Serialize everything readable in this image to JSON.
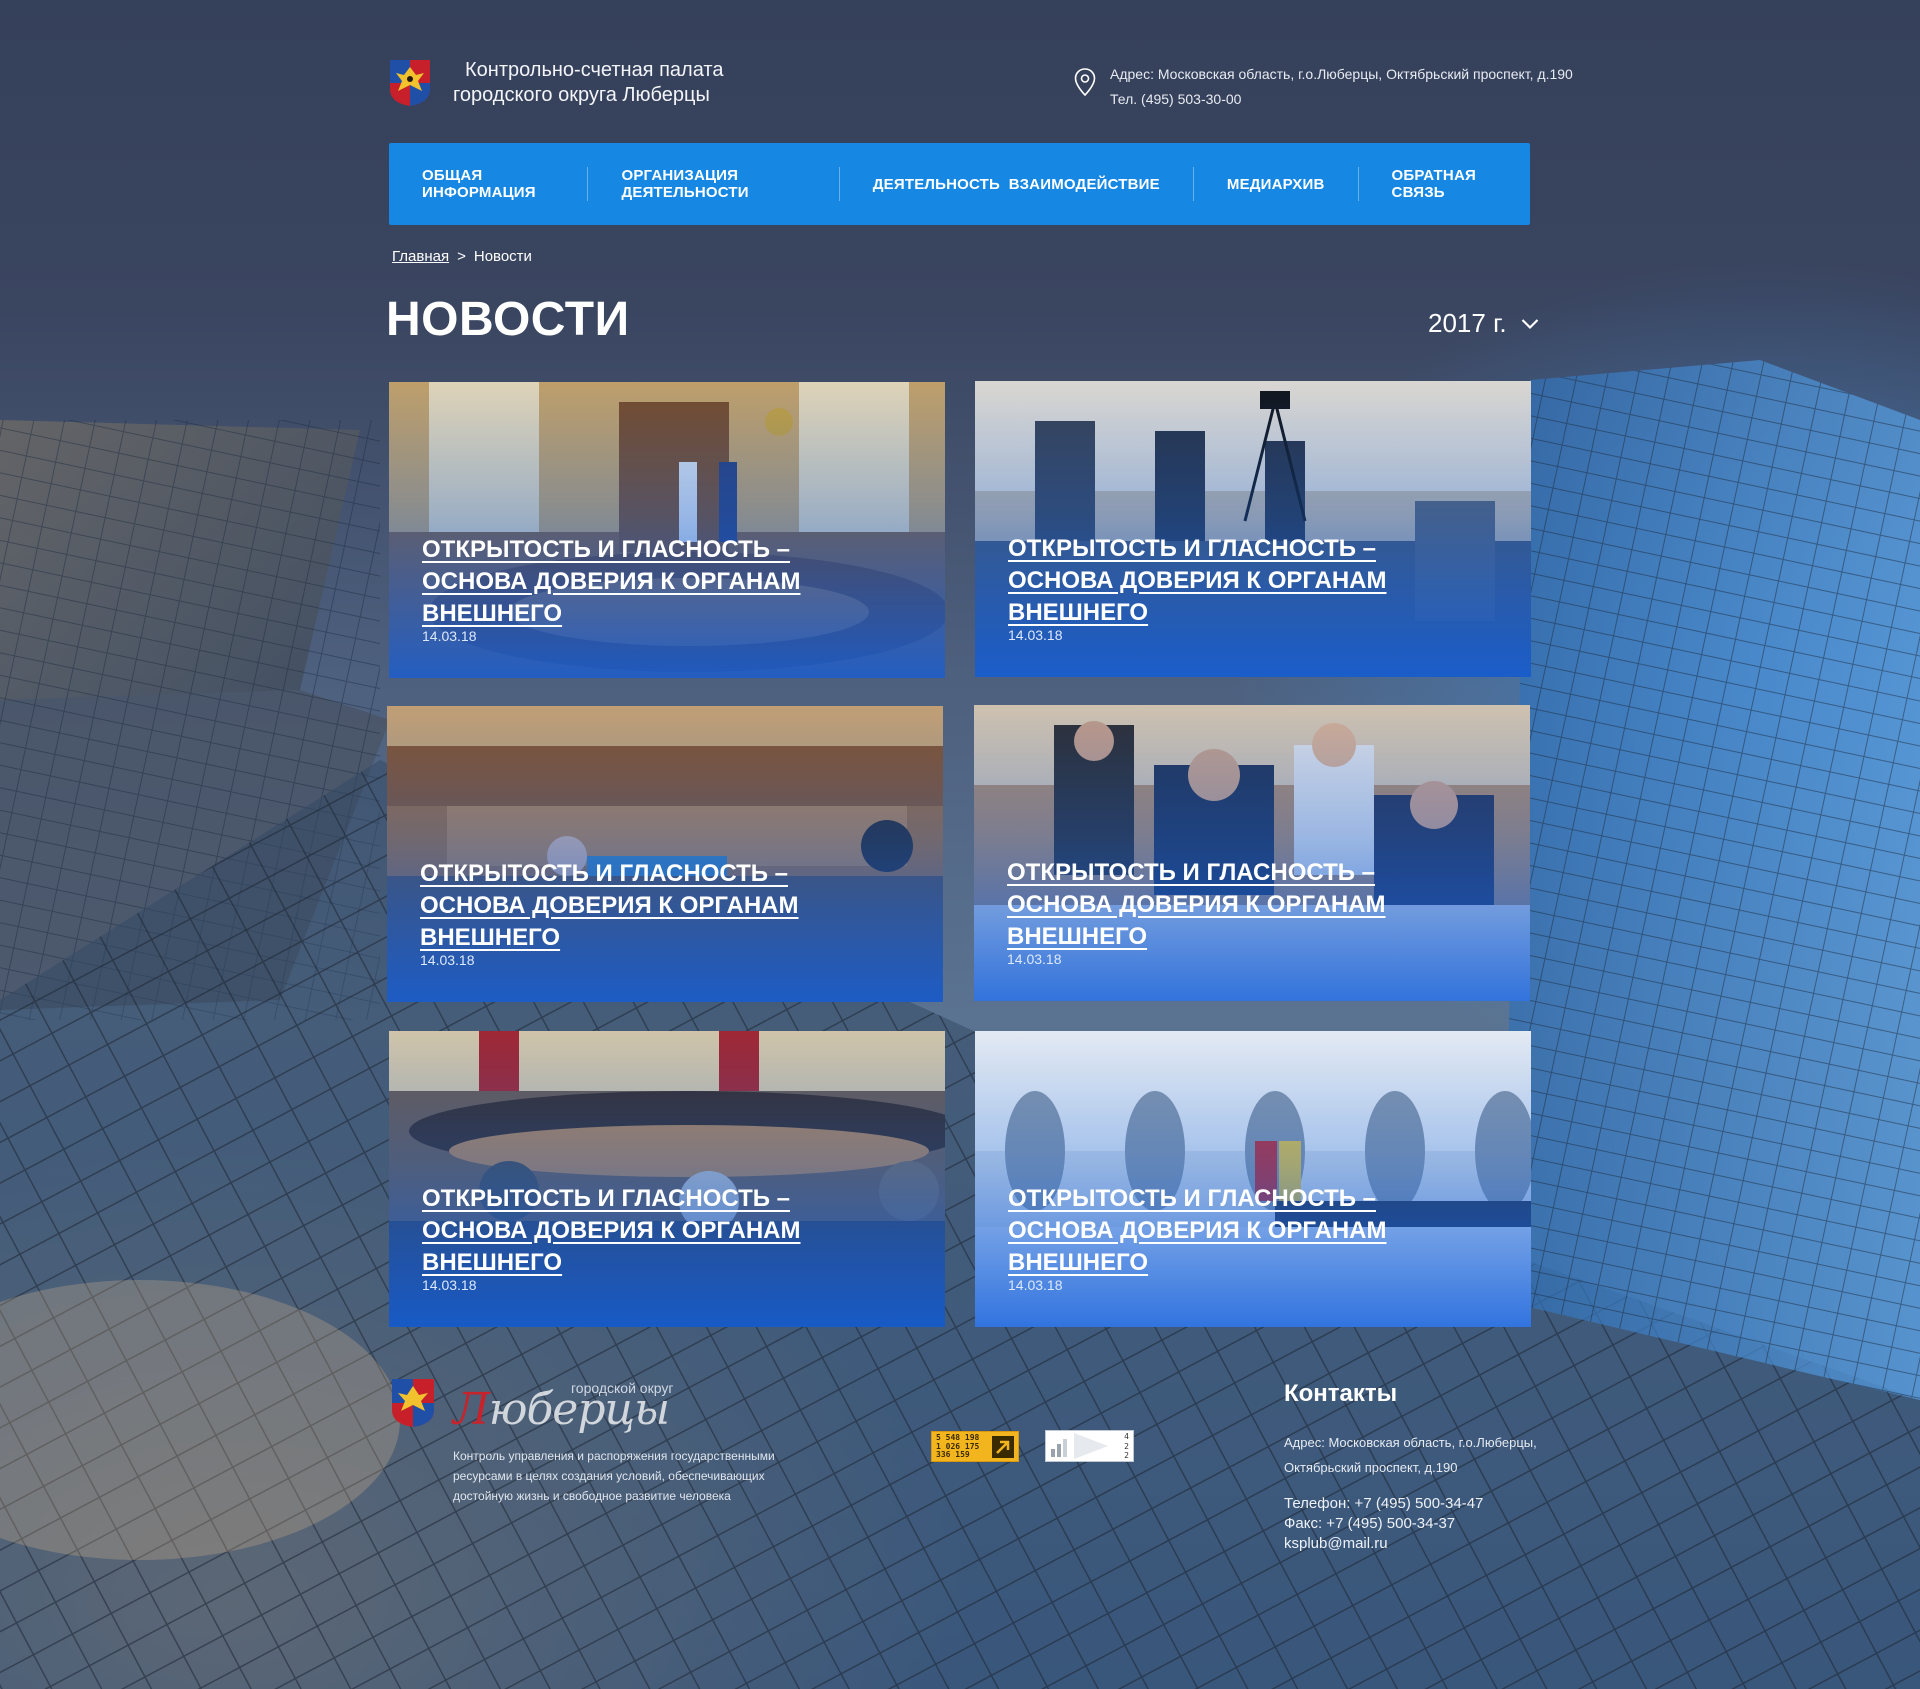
{
  "header": {
    "site_name_line1": "Контрольно-счетная палата",
    "site_name_line2": "городского округа Люберцы",
    "address": "Адрес: Московская область, г.о.Люберцы, Октябрьский проспект, д.190",
    "phone": "Тел. (495) 503-30-00",
    "icons": {
      "location": "map-pin-icon",
      "emblem": "coat-of-arms"
    }
  },
  "nav": {
    "items": [
      {
        "label": "Общая информация"
      },
      {
        "label": "Организация деятельности"
      },
      {
        "label": "Деятельность  Взаимодействие"
      },
      {
        "label": "Медиархив"
      },
      {
        "label": "Обратная связь"
      }
    ],
    "color": "#1688e4"
  },
  "breadcrumb": {
    "home": "Главная",
    "separator": ">",
    "current": "Новости"
  },
  "page_title": "НОВОСТИ",
  "year_filter": {
    "value": "2017 г.",
    "icon": "chevron-down-icon"
  },
  "news": [
    {
      "title": "Открытость и гласность – основа доверия к органам внешнего",
      "date": "14.03.18"
    },
    {
      "title": "Открытость и гласность – основа доверия к органам внешнего",
      "date": "14.03.18"
    },
    {
      "title": "Открытость и гласность – основа доверия к органам внешнего",
      "date": "14.03.18"
    },
    {
      "title": "Открытость и гласность – основа доверия к органам внешнего",
      "date": "14.03.18"
    },
    {
      "title": "Открытость и гласность – основа доверия к органам внешнего",
      "date": "14.03.18"
    },
    {
      "title": "Открытость и гласность – основа доверия к органам внешнего",
      "date": "14.03.18"
    }
  ],
  "footer": {
    "brand_small": "городской округ",
    "brand_big_first": "Л",
    "brand_big_rest": "юберцы",
    "mission": "Контроль управления и распоряжения государственными ресурсами в целях создания условий, обеспечивающих достойную жизнь и свободное развитие человека",
    "counter1_lines": [
      "5 548 198",
      "1 026 175",
      "336 159"
    ],
    "counter2_lines": [
      "4",
      "2",
      "2"
    ],
    "contacts_title": "Контакты",
    "contacts_address": "Адрес: Московская область, г.о.Люберцы, Октябрьский проспект, д.190",
    "phone": "Телефон: +7 (495) 500-34-47",
    "fax": "Факс: +7 (495) 500-34-37",
    "email": "ksplub@mail.ru"
  }
}
